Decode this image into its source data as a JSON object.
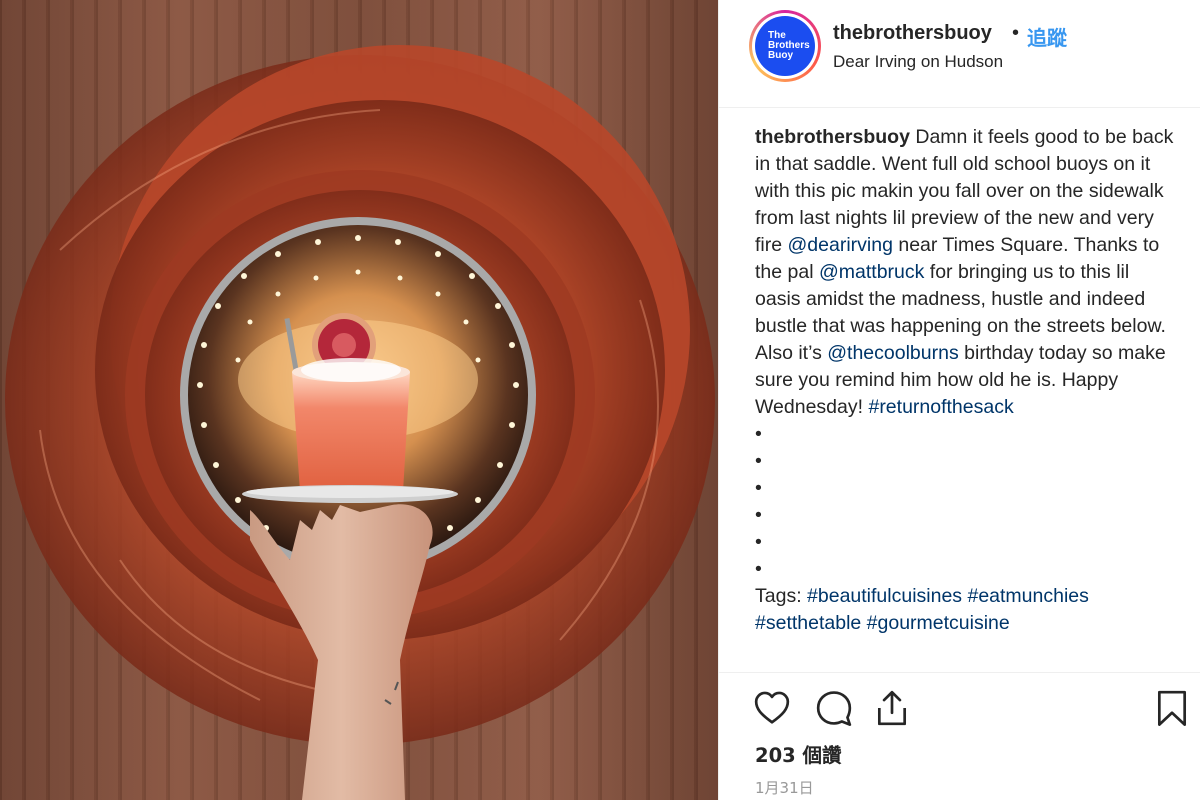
{
  "post": {
    "username": "thebrothersbuoy",
    "separator": "•",
    "follow_label": "追蹤",
    "location": "Dear Irving on Hudson",
    "avatar": {
      "logo_lines": [
        "The",
        "Brothers",
        "Buoy"
      ],
      "background": "#1b4df0"
    },
    "photo": {
      "icon": "cocktail-photo"
    }
  },
  "caption": {
    "username": "thebrothersbuoy",
    "t1": " Damn it feels good to be back in that saddle. Went full old school buoys on it with this pic makin you fall over on the sidewalk from last nights lil preview of the new and very fire ",
    "mention1": "@dearirving",
    "t2": " near Times Square. Thanks to the pal ",
    "mention2": "@mattbruck",
    "t3": " for bringing us to this lil oasis amidst the madness, hustle and indeed bustle that was happening on the streets below. Also it’s ",
    "mention3": "@thecoolburns",
    "t4": " birthday today so make sure you remind him how old he is. Happy Wednesday! ",
    "hashtag": "#returnofthesack",
    "bullets": [
      "",
      "",
      "",
      "",
      "",
      ""
    ],
    "tags_label": "Tags: ",
    "tag1": "#beautifulcuisines",
    "tag2": "#eatmunchies",
    "tag3_partial": "#setthetable #gourmetcuisine"
  },
  "actions": {
    "like_icon": "heart-icon",
    "comment_icon": "comment-icon",
    "share_icon": "share-icon",
    "save_icon": "bookmark-icon",
    "likes_text": "203 個讚",
    "date_text": "1月31日"
  },
  "colors": {
    "link": "#003569",
    "follow": "#3897f0",
    "text": "#262626",
    "muted": "#999999"
  }
}
